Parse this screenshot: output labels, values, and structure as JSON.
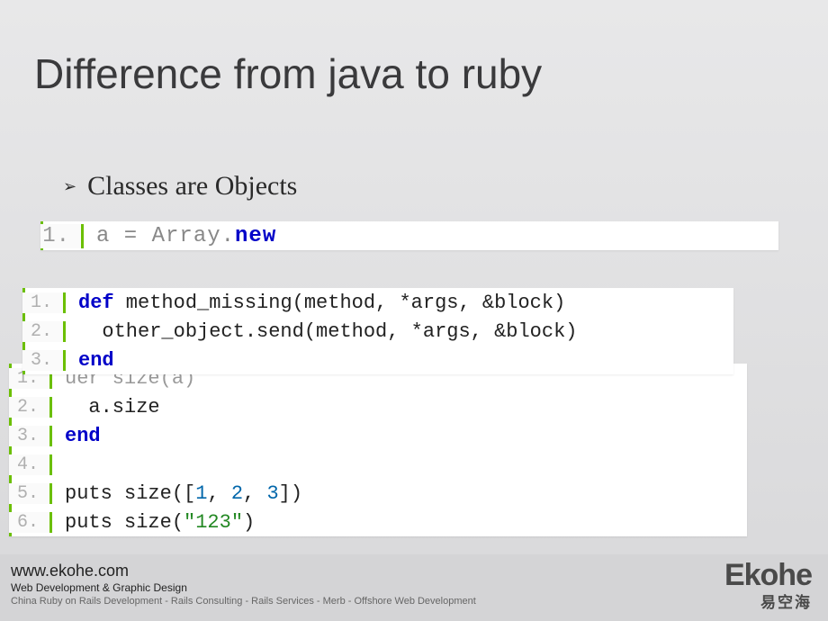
{
  "title": "Difference from java to ruby",
  "bullet": "Classes are Objects",
  "code1": {
    "line1_num": "1.",
    "line1_a": "a = ",
    "line1_b": "Array",
    "line1_c": ".",
    "line1_d": "new"
  },
  "code2": {
    "l1_num": "1.",
    "l1_kw": "def",
    "l1_rest": " method_missing(method, *args, &block)",
    "l2_num": "2.",
    "l2": "  other_object.send(method, *args, &block)",
    "l3_num": "3.",
    "l3_kw": "end"
  },
  "code3": {
    "l1_num": "1.",
    "l1_faded": "uer size(a)",
    "l2_num": "2.",
    "l2": "  a.size",
    "l3_num": "3.",
    "l3_kw": "end",
    "l4_num": "4.",
    "l4": "",
    "l5_num": "5.",
    "l5_a": "puts size([",
    "l5_n1": "1",
    "l5_c1": ", ",
    "l5_n2": "2",
    "l5_c2": ", ",
    "l5_n3": "3",
    "l5_b": "])",
    "l6_num": "6.",
    "l6_a": "puts size(",
    "l6_str": "\"123\"",
    "l6_b": ")"
  },
  "footer": {
    "url": "www.ekohe.com",
    "sub": "Web Development & Graphic Design",
    "desc": "China Ruby on Rails Development - Rails Consulting - Rails Services - Merb - Offshore Web Development"
  },
  "logo": {
    "main": "Ekohe",
    "sub": "易空海"
  }
}
